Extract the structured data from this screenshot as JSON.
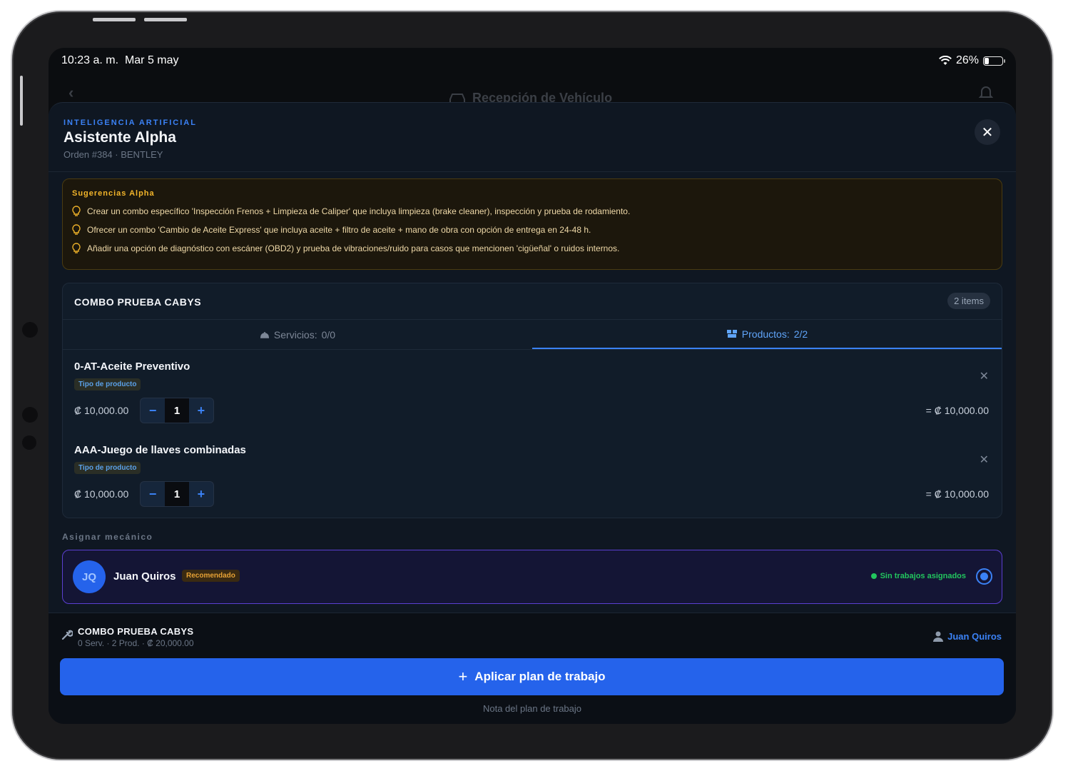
{
  "status_bar": {
    "time": "10:23 a. m.",
    "date": "Mar 5 may",
    "battery": "26%",
    "battery_level": 0.26
  },
  "background_nav": {
    "title": "Recepción de Vehículo"
  },
  "sheet": {
    "kicker": "INTELIGENCIA ARTIFICIAL",
    "title": "Asistente Alpha",
    "subtitle": "Orden #384 · BENTLEY",
    "close_icon": "close-icon"
  },
  "suggestions": {
    "title": "Sugerencias Alpha",
    "items": [
      "Crear un combo específico 'Inspección Frenos + Limpieza de Caliper' que incluya limpieza (brake cleaner), inspección y prueba de rodamiento.",
      "Ofrecer un combo 'Cambio de Aceite Express' que incluya aceite + filtro de aceite + mano de obra con opción de entrega en 24-48 h.",
      "Añadir una opción de diagnóstico con escáner (OBD2) y prueba de vibraciones/ruido para casos que mencionen 'cigüeñal' o ruidos internos."
    ]
  },
  "combo": {
    "title": "COMBO PRUEBA CABYS",
    "items_badge": "2 items",
    "tabs": [
      {
        "label": "Servicios:",
        "count": "0/0",
        "active": false,
        "icon": "service-bell-icon"
      },
      {
        "label": "Productos:",
        "count": "2/2",
        "active": true,
        "icon": "boxes-icon"
      }
    ],
    "products": [
      {
        "name": "0-AT-Aceite Preventivo",
        "tag": "Tipo de producto",
        "price": "₡ 10,000.00",
        "qty": "1",
        "total": "= ₡ 10,000.00"
      },
      {
        "name": "AAA-Juego de llaves combinadas",
        "tag": "Tipo de producto",
        "price": "₡ 10,000.00",
        "qty": "1",
        "total": "= ₡ 10,000.00"
      }
    ]
  },
  "assign": {
    "label": "Asignar mecánico",
    "mechanic": {
      "initials": "JQ",
      "name": "Juan Quiros",
      "badge": "Recomendado",
      "status": "Sin trabajos asignados",
      "selected": true
    }
  },
  "footer": {
    "title": "COMBO PRUEBA CABYS",
    "summary": "0 Serv. · 2 Prod. · ₡ 20,000.00",
    "assignee": "Juan Quiros",
    "apply_label": "Aplicar plan de trabajo",
    "note": "Nota del plan de trabajo"
  },
  "colors": {
    "accent": "#2563eb",
    "warning": "#f3b52a",
    "success": "#22c55e",
    "highlight_border": "#5b3fd1"
  }
}
